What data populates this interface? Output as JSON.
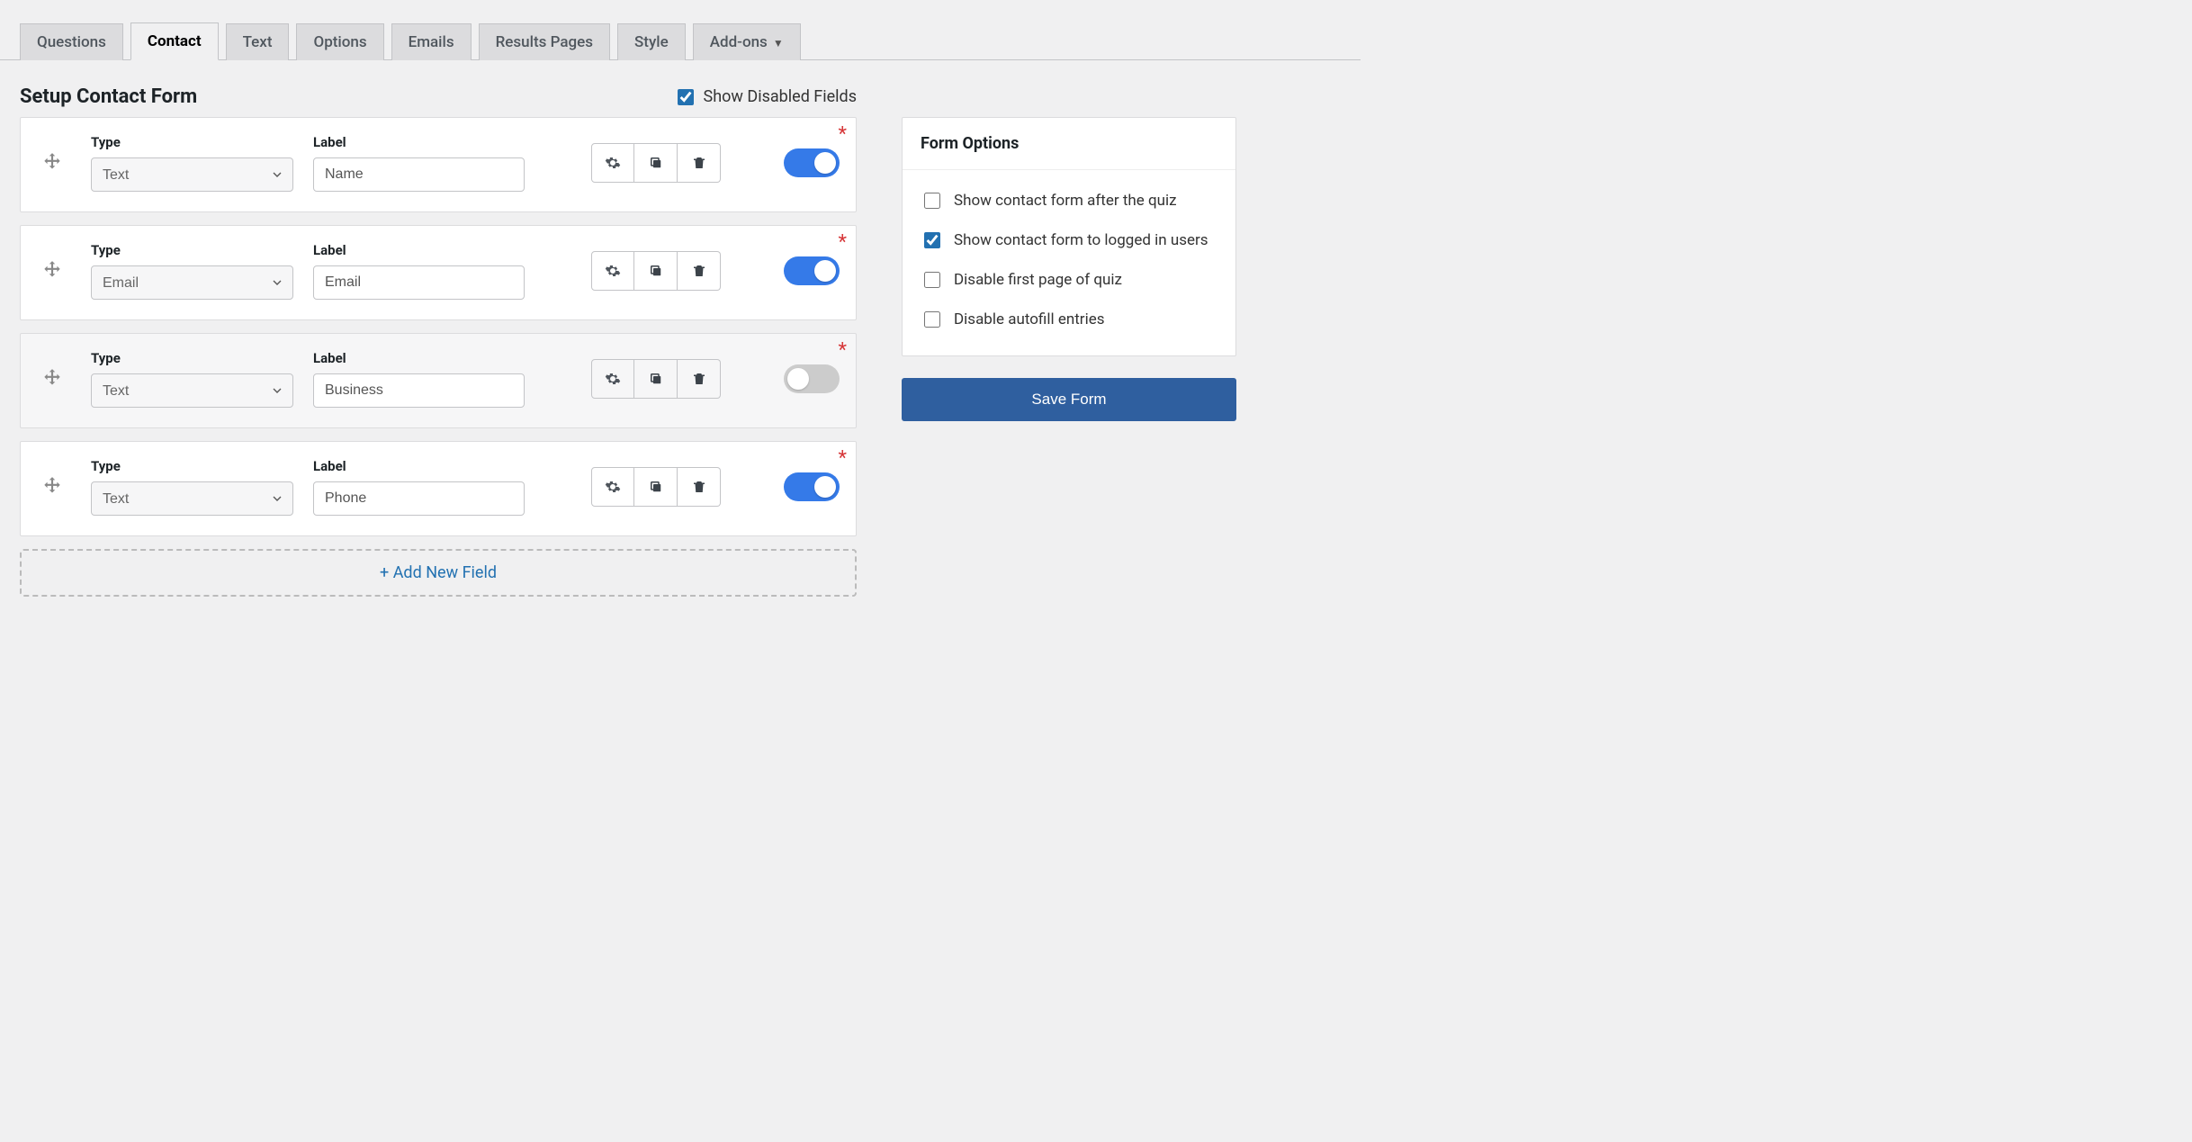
{
  "tabs": [
    {
      "label": "Questions",
      "active": false
    },
    {
      "label": "Contact",
      "active": true
    },
    {
      "label": "Text",
      "active": false
    },
    {
      "label": "Options",
      "active": false
    },
    {
      "label": "Emails",
      "active": false
    },
    {
      "label": "Results Pages",
      "active": false
    },
    {
      "label": "Style",
      "active": false
    },
    {
      "label": "Add-ons",
      "active": false,
      "caret": true
    }
  ],
  "page_title": "Setup Contact Form",
  "show_disabled": {
    "label": "Show Disabled Fields",
    "checked": true
  },
  "column_headers": {
    "type": "Type",
    "label": "Label"
  },
  "type_options": [
    "Text",
    "Email"
  ],
  "fields": [
    {
      "type": "Text",
      "label": "Name",
      "enabled": true,
      "required": true
    },
    {
      "type": "Email",
      "label": "Email",
      "enabled": true,
      "required": true
    },
    {
      "type": "Text",
      "label": "Business",
      "enabled": false,
      "required": true
    },
    {
      "type": "Text",
      "label": "Phone",
      "enabled": true,
      "required": true
    }
  ],
  "add_new_label": "+ Add New Field",
  "form_options": {
    "title": "Form Options",
    "items": [
      {
        "label": "Show contact form after the quiz",
        "checked": false
      },
      {
        "label": "Show contact form to logged in users",
        "checked": true
      },
      {
        "label": "Disable first page of quiz",
        "checked": false
      },
      {
        "label": "Disable autofill entries",
        "checked": false
      }
    ]
  },
  "save_label": "Save Form"
}
